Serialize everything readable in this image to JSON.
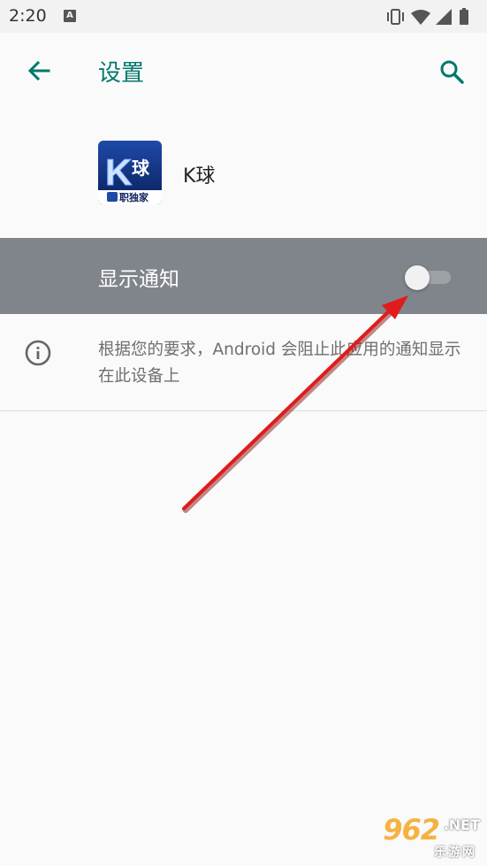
{
  "status_bar": {
    "time": "2:20",
    "notification_letter": "A",
    "icons": [
      "vibrate-icon",
      "wifi-icon",
      "signal-icon",
      "battery-icon"
    ]
  },
  "app_bar": {
    "title": "设置",
    "accent_color": "#00796b"
  },
  "app": {
    "name": "K球",
    "icon_letter": "K",
    "icon_glyph": "球",
    "icon_caption": "职独家"
  },
  "notification_toggle": {
    "label": "显示通知",
    "checked": false
  },
  "info": {
    "text": "根据您的要求，Android 会阻止此应用的通知显示在此设备上"
  },
  "watermark": {
    "main": "962",
    "net": ".NET",
    "sub": "乐游网"
  }
}
